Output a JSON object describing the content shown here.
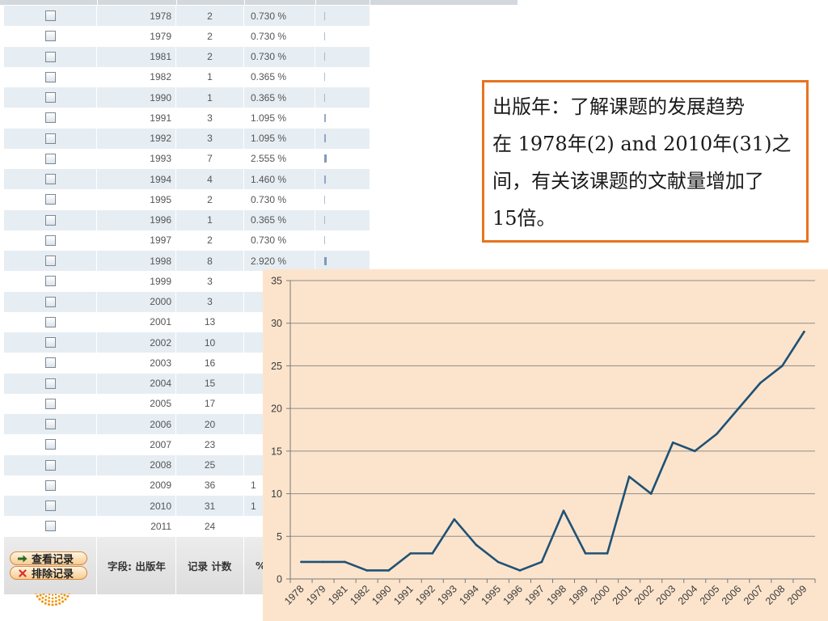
{
  "colors": {
    "accent": "#e8731e",
    "chart_bg": "#fce4cc",
    "series": "#1f5276",
    "row_alt": "#e6edf3",
    "bar": "#7f98b8",
    "logo": "#f39200"
  },
  "icons": {
    "view_button": "arrow-right-icon",
    "exclude_button": "close-icon",
    "row_select": "checkbox",
    "brand": "logo-icon"
  },
  "table": {
    "rows": [
      {
        "year": "1978",
        "count": "2",
        "pct": "0.730 %"
      },
      {
        "year": "1979",
        "count": "2",
        "pct": "0.730 %"
      },
      {
        "year": "1981",
        "count": "2",
        "pct": "0.730 %"
      },
      {
        "year": "1982",
        "count": "1",
        "pct": "0.365 %"
      },
      {
        "year": "1990",
        "count": "1",
        "pct": "0.365 %"
      },
      {
        "year": "1991",
        "count": "3",
        "pct": "1.095 %"
      },
      {
        "year": "1992",
        "count": "3",
        "pct": "1.095 %"
      },
      {
        "year": "1993",
        "count": "7",
        "pct": "2.555 %"
      },
      {
        "year": "1994",
        "count": "4",
        "pct": "1.460 %"
      },
      {
        "year": "1995",
        "count": "2",
        "pct": "0.730 %"
      },
      {
        "year": "1996",
        "count": "1",
        "pct": "0.365 %"
      },
      {
        "year": "1997",
        "count": "2",
        "pct": "0.730 %"
      },
      {
        "year": "1998",
        "count": "8",
        "pct": "2.920 %"
      },
      {
        "year": "1999",
        "count": "3",
        "pct": ""
      },
      {
        "year": "2000",
        "count": "3",
        "pct": ""
      },
      {
        "year": "2001",
        "count": "13",
        "pct": ""
      },
      {
        "year": "2002",
        "count": "10",
        "pct": ""
      },
      {
        "year": "2003",
        "count": "16",
        "pct": ""
      },
      {
        "year": "2004",
        "count": "15",
        "pct": ""
      },
      {
        "year": "2005",
        "count": "17",
        "pct": ""
      },
      {
        "year": "2006",
        "count": "20",
        "pct": ""
      },
      {
        "year": "2007",
        "count": "23",
        "pct": ""
      },
      {
        "year": "2008",
        "count": "25",
        "pct": ""
      },
      {
        "year": "2009",
        "count": "36",
        "pct": "1"
      },
      {
        "year": "2010",
        "count": "31",
        "pct": "1"
      },
      {
        "year": "2011",
        "count": "24",
        "pct": ""
      }
    ]
  },
  "footer": {
    "view_button": "查看记录",
    "exclude_button": "排除记录",
    "field_label": "字段: 出版年",
    "count_label": "记录 计数",
    "pct_label": "%"
  },
  "note": {
    "line1": "出版年：了解课题的发展趋势",
    "line2": "在 1978年(2) and 2010年(31)之",
    "line3": "间，有关该课题的文献量增加了",
    "line4": "15倍。"
  },
  "chart_data": {
    "type": "line",
    "title": "",
    "xlabel": "",
    "ylabel": "",
    "categories": [
      "1978",
      "1979",
      "1981",
      "1982",
      "1990",
      "1991",
      "1992",
      "1993",
      "1994",
      "1995",
      "1996",
      "1997",
      "1998",
      "1999",
      "2000",
      "2001",
      "2002",
      "2003",
      "2004",
      "2005",
      "2006",
      "2007",
      "2008",
      "2009"
    ],
    "values": [
      2,
      2,
      2,
      1,
      1,
      3,
      3,
      7,
      4,
      2,
      1,
      2,
      8,
      3,
      3,
      12,
      10,
      16,
      15,
      17,
      20,
      23,
      25,
      29
    ],
    "ylim": [
      0,
      35
    ],
    "yticks": [
      0,
      5,
      10,
      15,
      20,
      25,
      30,
      35
    ],
    "grid": true,
    "legend": "none"
  }
}
